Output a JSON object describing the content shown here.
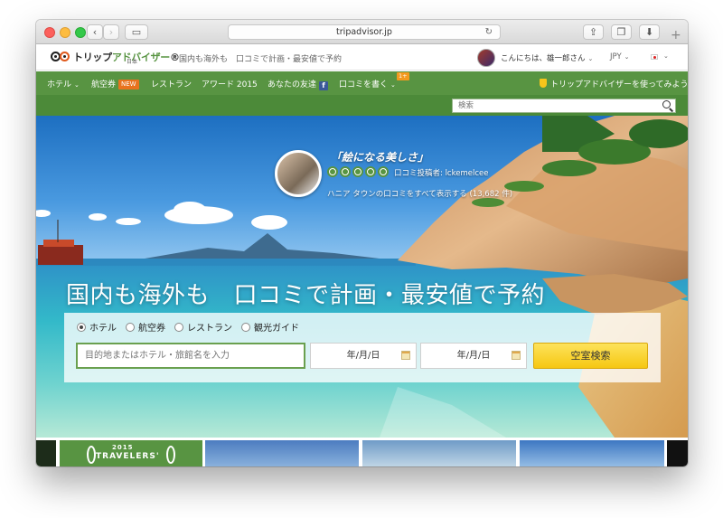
{
  "browser": {
    "url": "tripadvisor.jp",
    "reload_icon": "↻",
    "plus_icon": "+"
  },
  "header": {
    "logo_main": "トリップ",
    "logo_green": "アドバイザー",
    "logo_mark": "®",
    "logo_sub": "日本",
    "tagline": "国内も海外も　口コミで計画・最安値で予約",
    "greeting": "こんにちは、雄一郎さん",
    "currency": "JPY"
  },
  "nav": {
    "hotel": "ホテル",
    "flights": "航空券",
    "new_badge": "NEW",
    "restaurant": "レストラン",
    "award": "アワード 2015",
    "friends": "あなたの友達",
    "fb": "f",
    "write_review": "口コミを書く",
    "badge_count": "1+",
    "try_app": "トリップアドバイザーを使ってみよう"
  },
  "search": {
    "placeholder": "検索"
  },
  "hero": {
    "quote": "「絵になる美しさ」",
    "rating": 5,
    "reviewer": "口コミ投稿者: lckemelcee",
    "reviews_link": "ハニア タウンの口コミをすべて表示する (13,682 件)",
    "headline": "国内も海外も　口コミで計画・最安値で予約"
  },
  "booking": {
    "radios": [
      "ホテル",
      "航空券",
      "レストラン",
      "観光ガイド"
    ],
    "selected": 0,
    "destination_placeholder": "目的地またはホテル・旅館名を入力",
    "checkin": "年/月/日",
    "checkout": "年/月/日",
    "submit": "空室検索"
  },
  "thumbs": {
    "award_year": "2015",
    "award_text": "TRAVELERS'"
  },
  "colors": {
    "brand_green": "#589442",
    "search_button": "#f6c712",
    "new_badge": "#e8731e"
  }
}
